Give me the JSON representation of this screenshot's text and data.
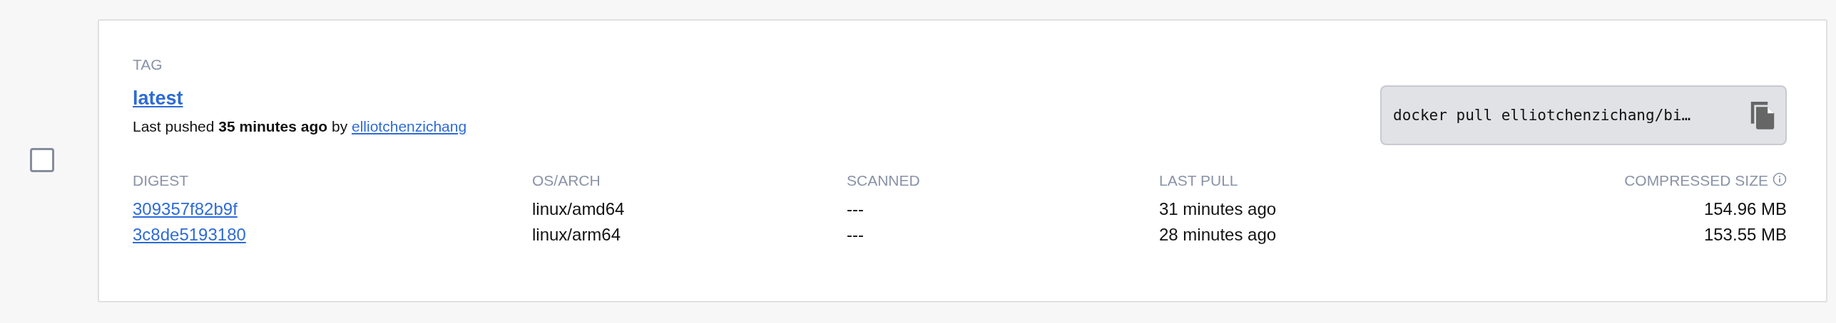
{
  "select": {
    "checked": false
  },
  "tag": {
    "label": "TAG",
    "name": "latest",
    "pushed": "Last pushed **35 minutes ago** by ",
    "user": "elliotchenzichang"
  },
  "pull_command": {
    "text": "docker pull elliotchenzichang/bi…"
  },
  "table": {
    "columns": [
      {
        "label": "DIGEST",
        "info": false
      },
      {
        "label": "OS/ARCH",
        "info": false
      },
      {
        "label": "SCANNED",
        "info": false
      },
      {
        "label": "LAST PULL",
        "info": false
      },
      {
        "label": "COMPRESSED SIZE",
        "info": true
      }
    ],
    "rows": [
      {
        "digest": "309357f82b9f",
        "os_arch": "linux/amd64",
        "scanned": "---",
        "last_pull": "31 minutes ago",
        "size": "154.96 MB"
      },
      {
        "digest": "3c8de5193180",
        "os_arch": "linux/arm64",
        "scanned": "---",
        "last_pull": "28 minutes ago",
        "size": "153.55 MB"
      }
    ]
  }
}
